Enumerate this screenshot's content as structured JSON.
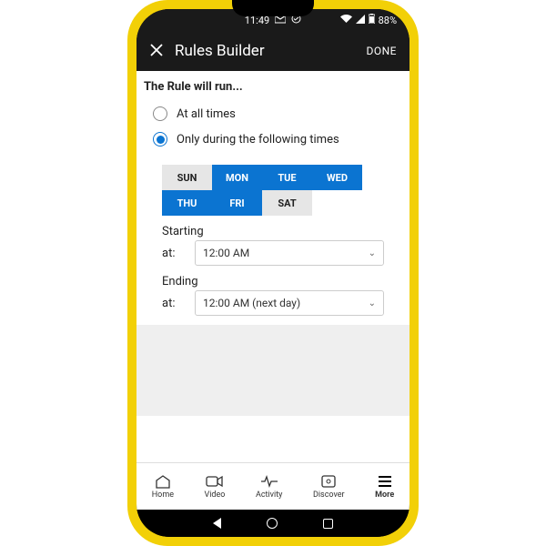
{
  "status": {
    "time": "11:49",
    "battery": "88%"
  },
  "header": {
    "title": "Rules Builder",
    "done": "DONE"
  },
  "section_title": "The Rule will run...",
  "options": {
    "all_times": "At all times",
    "only_times": "Only during the following times",
    "selected": "only_times"
  },
  "days": [
    {
      "short": "SUN",
      "on": false
    },
    {
      "short": "MON",
      "on": true
    },
    {
      "short": "TUE",
      "on": true
    },
    {
      "short": "WED",
      "on": true
    },
    {
      "short": "THU",
      "on": true
    },
    {
      "short": "FRI",
      "on": true
    },
    {
      "short": "SAT",
      "on": false
    }
  ],
  "starting": {
    "label": "Starting",
    "at": "at:",
    "value": "12:00 AM"
  },
  "ending": {
    "label": "Ending",
    "at": "at:",
    "value": "12:00 AM (next day)"
  },
  "nav": {
    "home": "Home",
    "video": "Video",
    "activity": "Activity",
    "discover": "Discover",
    "more": "More"
  }
}
